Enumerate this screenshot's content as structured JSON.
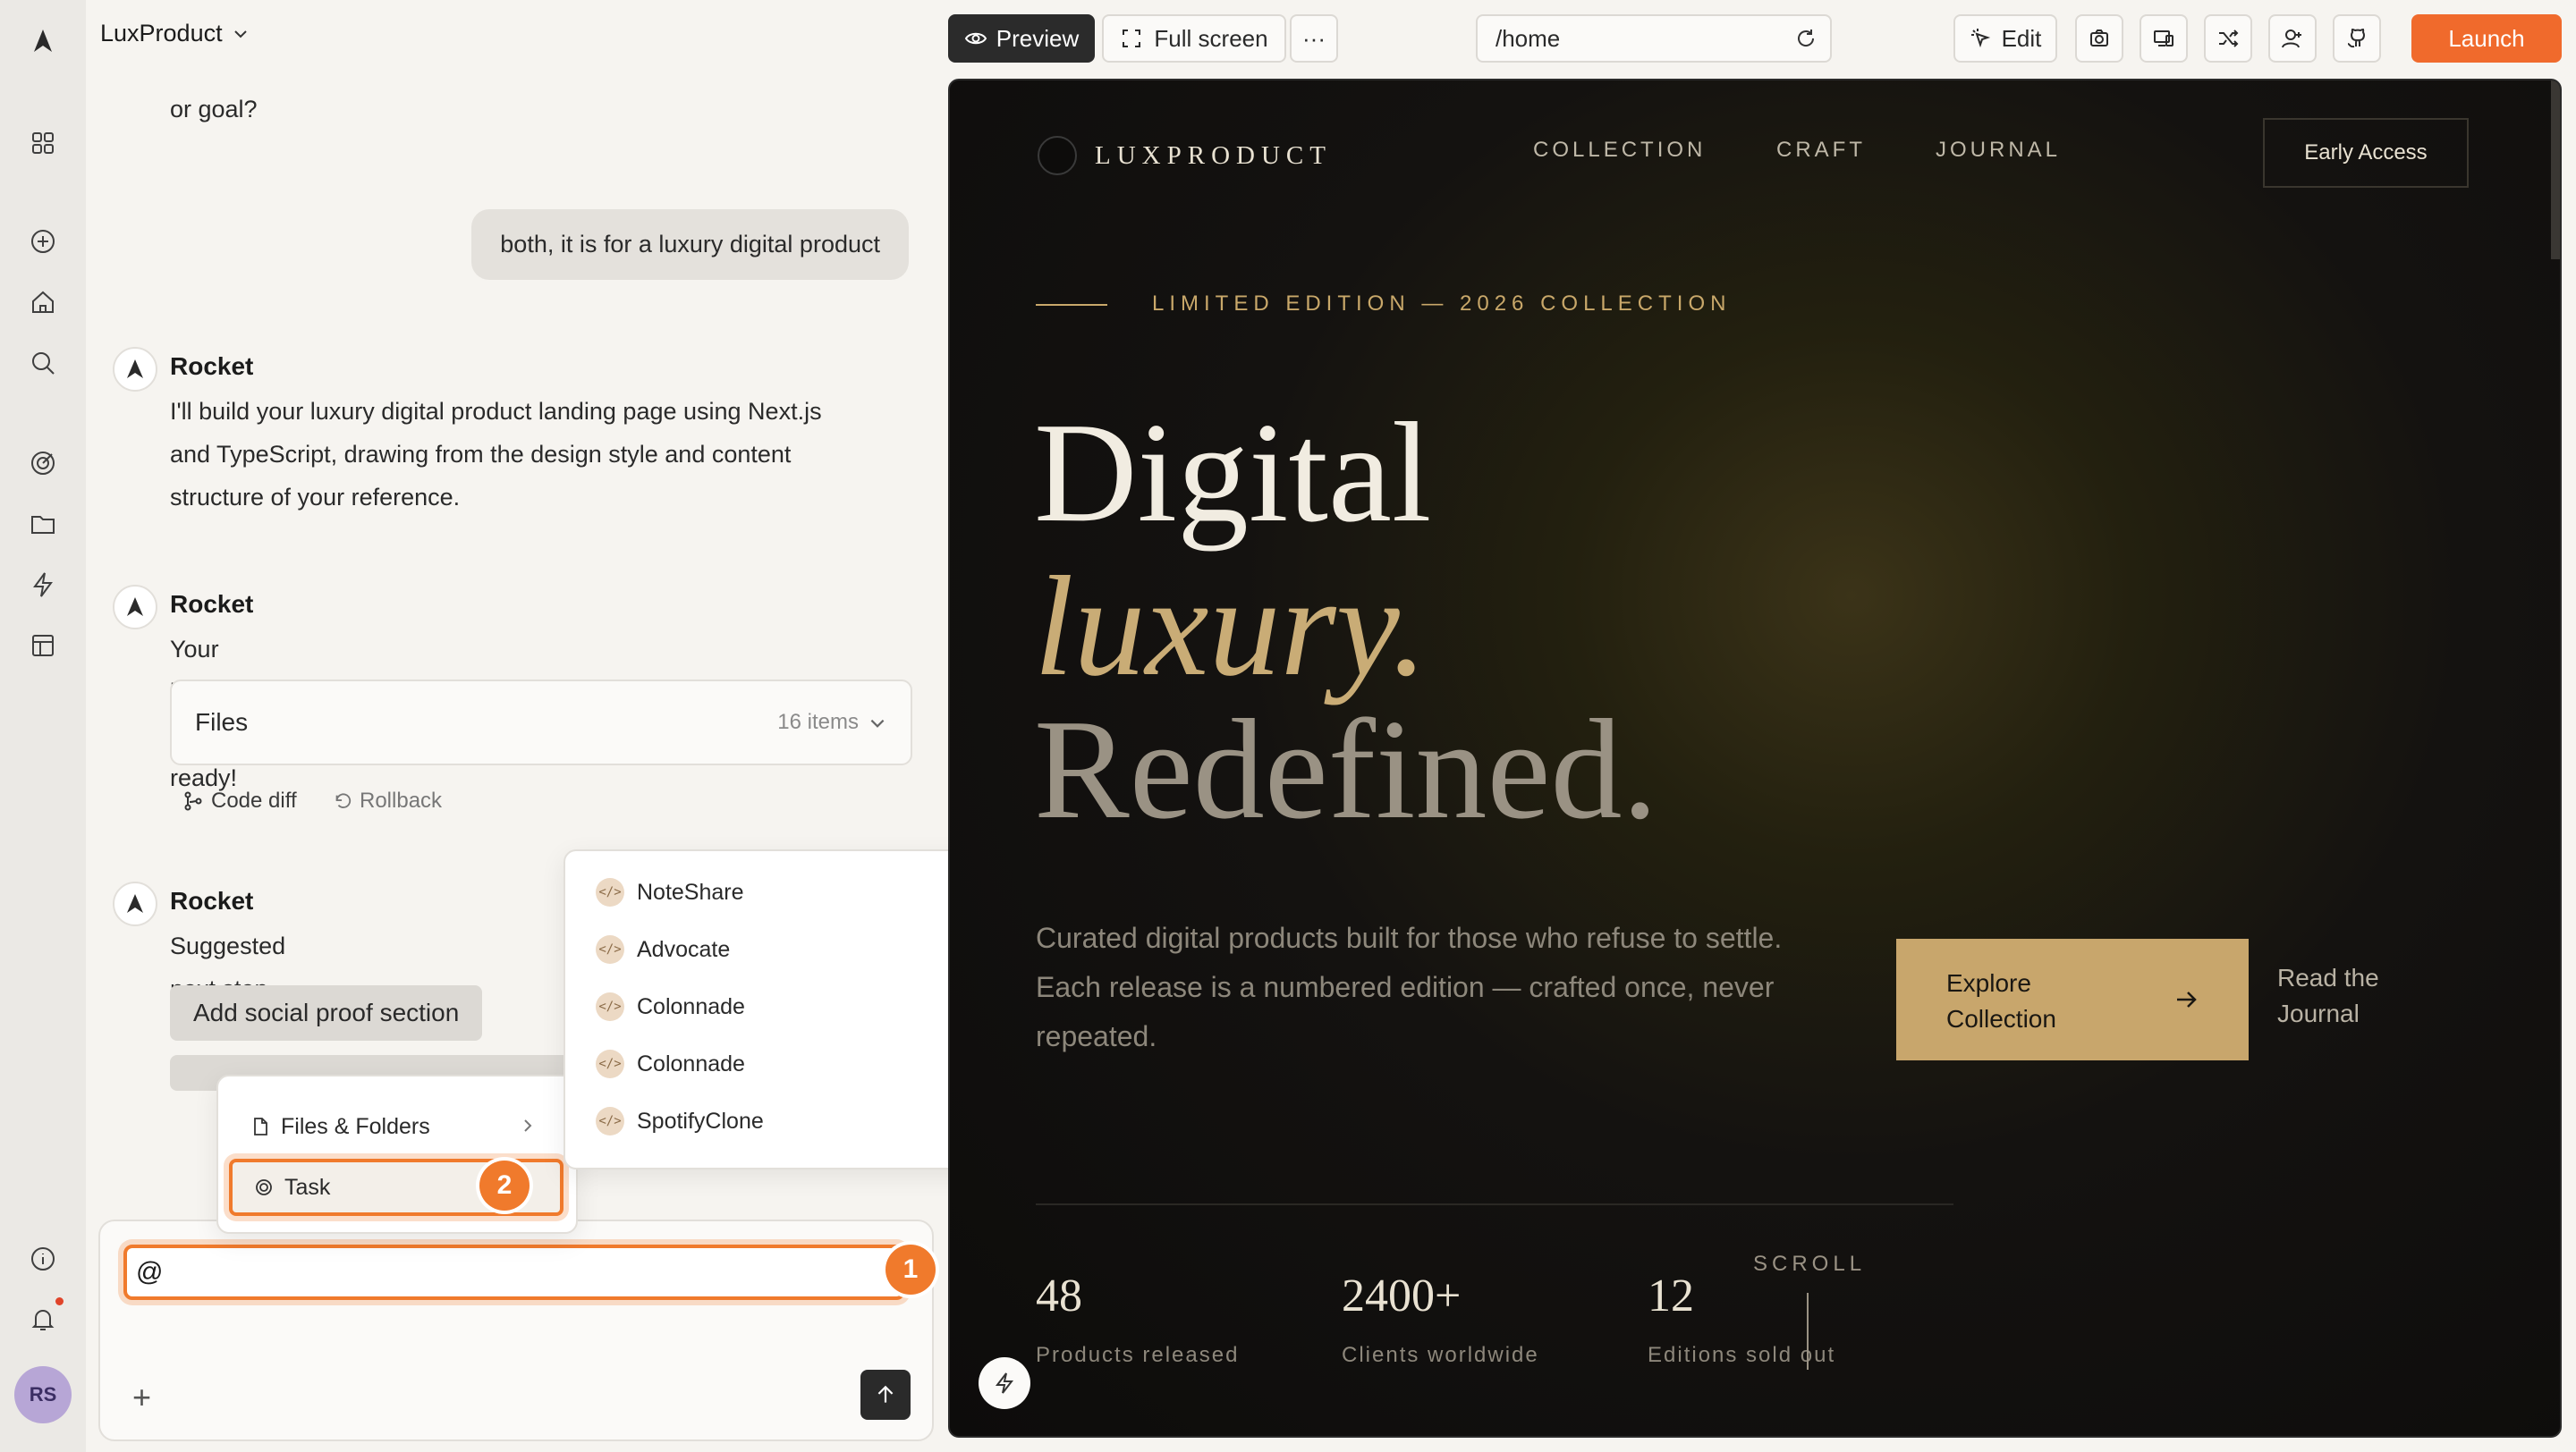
{
  "app": {
    "project_name": "LuxProduct"
  },
  "rail": {
    "icons": [
      "logo-icon",
      "apps-icon",
      "plus-circle-icon",
      "home-icon",
      "search-icon",
      "target-icon",
      "folder-icon",
      "bolt-icon",
      "layout-icon",
      "info-icon",
      "bell-icon"
    ],
    "avatar_initials": "RS"
  },
  "chat": {
    "prev_tail": "or goal?",
    "user_msg": "both, it is for a luxury digital product",
    "bot_name": "Rocket",
    "bot_msg1": [
      "I'll build your luxury digital product landing page using Next.js",
      "and TypeScript, drawing from the design style and content",
      "structure of your reference."
    ],
    "bot_msg2": "Your landing page is ready!",
    "files_label": "Files",
    "files_count": "16 items",
    "code_diff": "Code diff",
    "rollback": "Rollback",
    "bot_msg3": "Suggested next step",
    "suggestion": "Add social proof section"
  },
  "composer": {
    "value": "@"
  },
  "mention_menu": {
    "items": [
      {
        "label": "Files & Folders",
        "icon": "file-icon"
      },
      {
        "label": "Task",
        "icon": "target-icon"
      }
    ]
  },
  "task_menu": {
    "items": [
      "NoteShare",
      "Advocate",
      "Colonnade",
      "Colonnade",
      "SpotifyClone"
    ]
  },
  "callouts": [
    "1",
    "2"
  ],
  "toolbar": {
    "preview": "Preview",
    "fullscreen": "Full screen",
    "more": "···",
    "url": "/home",
    "edit": "Edit",
    "launch": "Launch"
  },
  "site": {
    "brand": "LUXPRODUCT",
    "nav": [
      "COLLECTION",
      "CRAFT",
      "JOURNAL"
    ],
    "early_access": "Early Access",
    "eyebrow": "LIMITED EDITION — 2026 COLLECTION",
    "h1_a": "Digital",
    "h1_b": "luxury.",
    "h1_c": "Redefined.",
    "sub": "Curated digital products built for those who refuse to settle. Each release is a numbered edition — crafted once, never repeated.",
    "cta_line1": "Explore",
    "cta_line2": "Collection",
    "read_line1": "Read the",
    "read_line2": "Journal",
    "stats": [
      {
        "num": "48",
        "label": "Products released"
      },
      {
        "num": "2400+",
        "label": "Clients worldwide"
      },
      {
        "num": "12",
        "label": "Editions sold out"
      }
    ],
    "scroll": "SCROLL"
  },
  "colors": {
    "accent": "#f06a2c",
    "gold": "#c8a66c",
    "dark": "#0d0c0b"
  }
}
